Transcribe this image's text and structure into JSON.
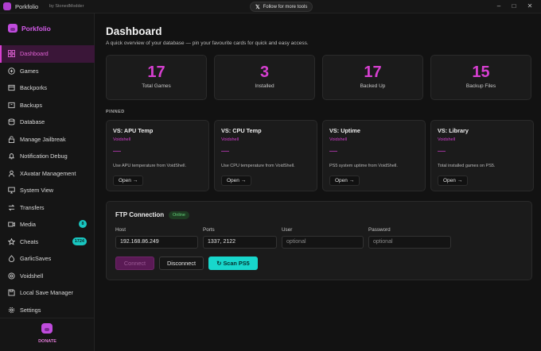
{
  "titlebar": {
    "app_name": "Porkfolio",
    "app_by": "by StonedModder",
    "follow_label": "Follow for more tools",
    "follow_icon": "x-logo-icon",
    "min_glyph": "–",
    "max_glyph": "□",
    "close_glyph": "✕"
  },
  "sidebar": {
    "brand": "Porkfolio",
    "items": [
      {
        "label": "Dashboard",
        "icon": "grid-icon",
        "active": true
      },
      {
        "label": "Games",
        "icon": "gamepad-icon"
      },
      {
        "label": "Backporks",
        "icon": "box-icon"
      },
      {
        "label": "Backups",
        "icon": "archive-icon"
      },
      {
        "label": "Database",
        "icon": "database-icon"
      },
      {
        "label": "Manage Jailbreak",
        "icon": "unlock-icon"
      },
      {
        "label": "Notification Debug",
        "icon": "bell-icon"
      },
      {
        "label": "XAvatar Management",
        "icon": "avatar-icon"
      },
      {
        "label": "System View",
        "icon": "monitor-icon"
      },
      {
        "label": "Transfers",
        "icon": "transfer-icon"
      },
      {
        "label": "Media",
        "icon": "video-icon",
        "badge": "8"
      },
      {
        "label": "Cheats",
        "icon": "star-icon",
        "badge": "1724"
      },
      {
        "label": "GarlicSaves",
        "icon": "garlic-icon"
      },
      {
        "label": "Voidshell",
        "icon": "shell-icon"
      },
      {
        "label": "Local Save Manager",
        "icon": "save-icon"
      },
      {
        "label": "Settings",
        "icon": "gear-icon"
      }
    ],
    "donate": "DONATE"
  },
  "main": {
    "title": "Dashboard",
    "subtitle": "A quick overview of your database — pin your favourite cards for quick and easy access.",
    "stats": [
      {
        "value": "17",
        "label": "Total Games"
      },
      {
        "value": "3",
        "label": "Installed"
      },
      {
        "value": "17",
        "label": "Backed Up"
      },
      {
        "value": "15",
        "label": "Backup Files"
      }
    ],
    "pinned_label": "PINNED",
    "pinned": [
      {
        "title": "VS: APU Temp",
        "source": "Voidshell",
        "value": "—",
        "desc": "Use APU temperature from VoidShell.",
        "open": "Open →"
      },
      {
        "title": "VS: CPU Temp",
        "source": "Voidshell",
        "value": "—",
        "desc": "Use CPU temperature from VoidShell.",
        "open": "Open →"
      },
      {
        "title": "VS: Uptime",
        "source": "Voidshell",
        "value": "—",
        "desc": "PS5 system uptime from VoidShell.",
        "open": "Open →"
      },
      {
        "title": "VS: Library",
        "source": "Voidshell",
        "value": "—",
        "desc": "Total installed games on PS5.",
        "open": "Open →"
      }
    ],
    "ftp": {
      "title": "FTP Connection",
      "status": "Online",
      "host_label": "Host",
      "host_value": "192.168.86.249",
      "ports_label": "Ports",
      "ports_value": "1337, 2122",
      "user_label": "User",
      "user_placeholder": "optional",
      "password_label": "Password",
      "password_placeholder": "optional",
      "connect": "Connect",
      "disconnect": "Disconnect",
      "scan": "↻ Scan PS5"
    }
  },
  "colors": {
    "accent": "#d63fd0",
    "teal": "#18d7cc",
    "online": "#66d37b"
  }
}
